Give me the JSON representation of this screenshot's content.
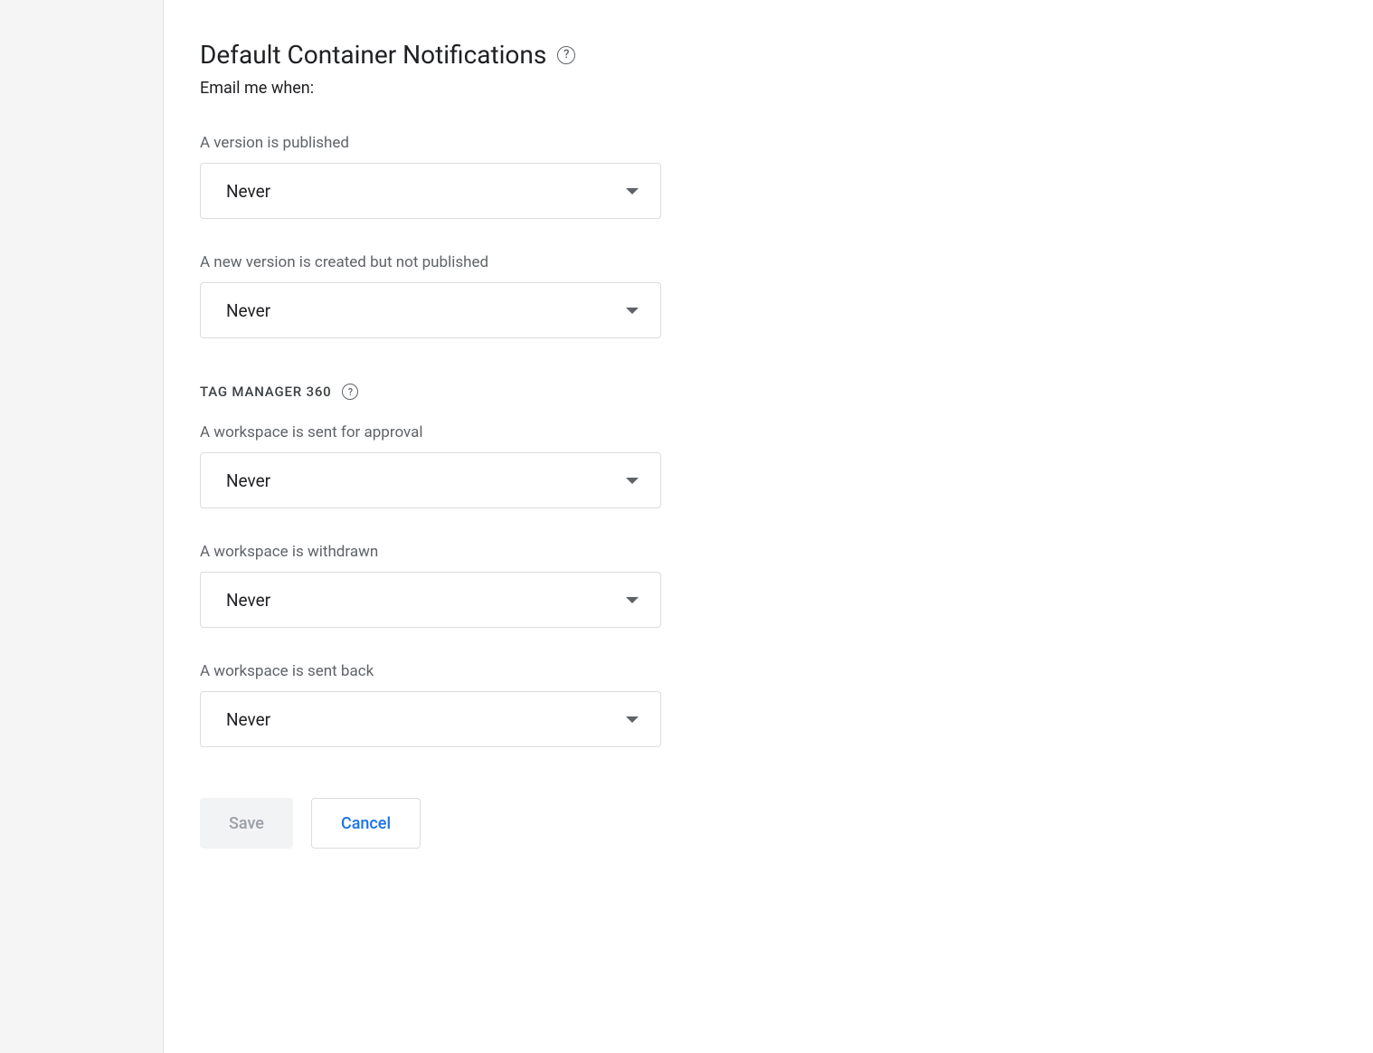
{
  "title": "Default Container Notifications",
  "subtitle": "Email me when:",
  "fields": {
    "version_published": {
      "label": "A version is published",
      "value": "Never"
    },
    "version_created": {
      "label": "A new version is created but not published",
      "value": "Never"
    }
  },
  "section360": {
    "heading": "TAG MANAGER 360",
    "fields": {
      "workspace_approval": {
        "label": "A workspace is sent for approval",
        "value": "Never"
      },
      "workspace_withdrawn": {
        "label": "A workspace is withdrawn",
        "value": "Never"
      },
      "workspace_sent_back": {
        "label": "A workspace is sent back",
        "value": "Never"
      }
    }
  },
  "buttons": {
    "save": "Save",
    "cancel": "Cancel"
  }
}
